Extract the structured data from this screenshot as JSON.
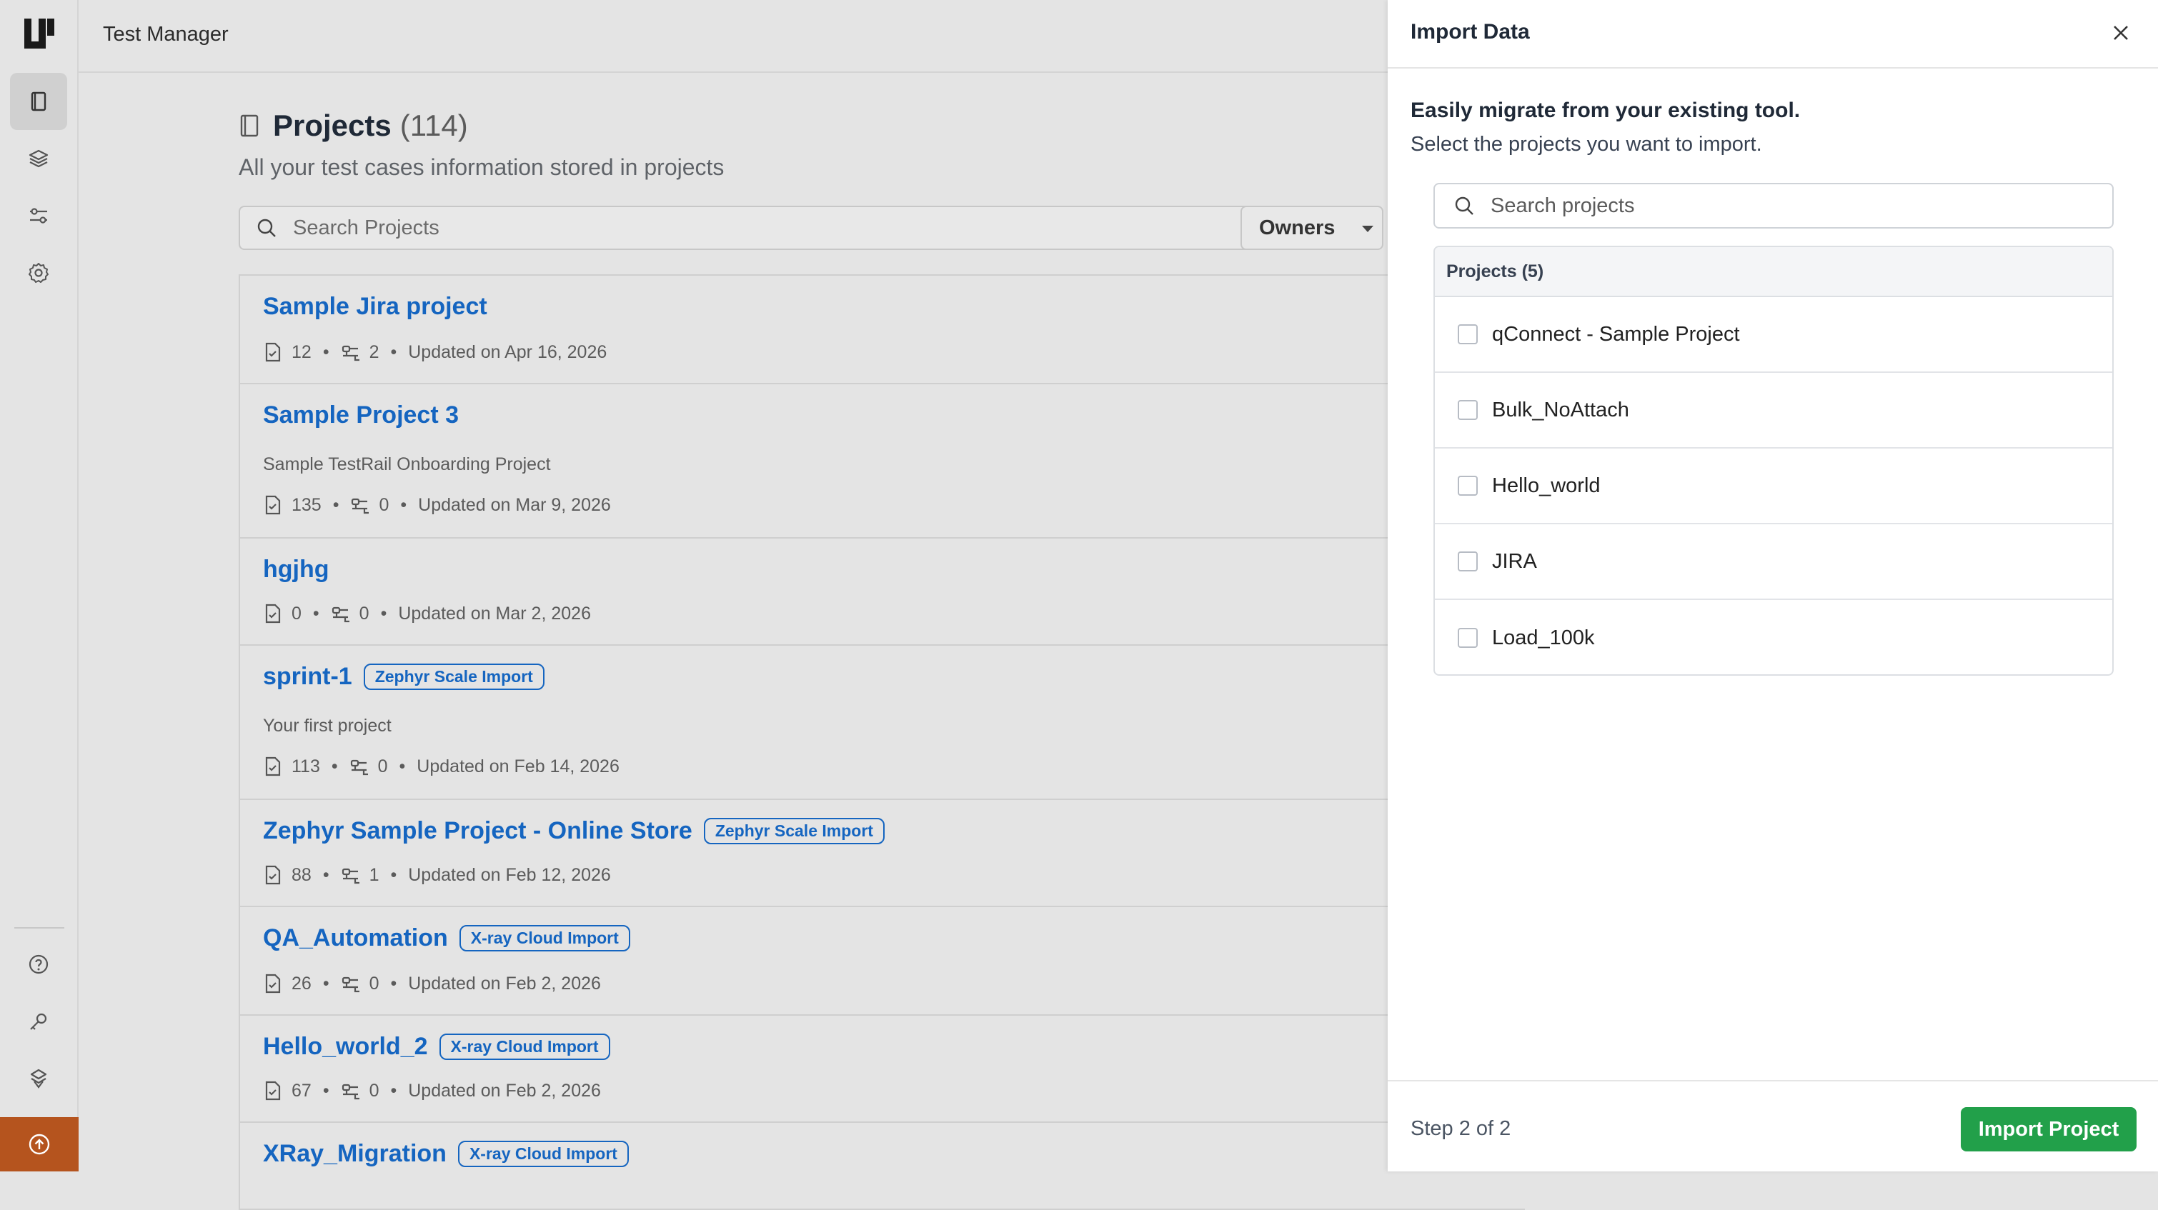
{
  "app": {
    "title": "Test Manager"
  },
  "rail": {
    "items": [
      {
        "icon": "book-icon",
        "active": true
      },
      {
        "icon": "layers-icon",
        "active": false
      },
      {
        "icon": "sliders-icon",
        "active": false
      },
      {
        "icon": "gear-icon",
        "active": false
      }
    ],
    "bottom": [
      "help-icon",
      "key-icon",
      "stack-icon",
      "upgrade-icon"
    ]
  },
  "projects_page": {
    "title": "Projects",
    "count": "(114)",
    "subtitle": "All your test cases information stored in projects",
    "search_placeholder": "Search Projects",
    "owners_label": "Owners",
    "items": [
      {
        "name": "Sample Jira project",
        "badge": "",
        "desc": "",
        "cases": "12",
        "runs": "2",
        "updated": "Updated on Apr 16, 2026"
      },
      {
        "name": "Sample Project 3",
        "badge": "",
        "desc": "Sample TestRail Onboarding Project",
        "cases": "135",
        "runs": "0",
        "updated": "Updated on Mar 9, 2026"
      },
      {
        "name": "hgjhg",
        "badge": "",
        "desc": "",
        "cases": "0",
        "runs": "0",
        "updated": "Updated on Mar 2, 2026"
      },
      {
        "name": "sprint-1",
        "badge": "Zephyr Scale Import",
        "desc": "Your first project",
        "cases": "113",
        "runs": "0",
        "updated": "Updated on Feb 14, 2026"
      },
      {
        "name": "Zephyr Sample Project - Online Store",
        "badge": "Zephyr Scale Import",
        "desc": "",
        "cases": "88",
        "runs": "1",
        "updated": "Updated on Feb 12, 2026"
      },
      {
        "name": "QA_Automation",
        "badge": "X-ray Cloud Import",
        "desc": "",
        "cases": "26",
        "runs": "0",
        "updated": "Updated on Feb 2, 2026"
      },
      {
        "name": "Hello_world_2",
        "badge": "X-ray Cloud Import",
        "desc": "",
        "cases": "67",
        "runs": "0",
        "updated": "Updated on Feb 2, 2026"
      },
      {
        "name": "XRay_Migration",
        "badge": "X-ray Cloud Import",
        "desc": "",
        "cases": "",
        "runs": "",
        "updated": ""
      }
    ]
  },
  "import_drawer": {
    "title": "Import Data",
    "intro_title": "Easily migrate from your existing tool.",
    "intro_sub": "Select the projects you want to import.",
    "search_placeholder": "Search projects",
    "table_header": "Projects (5)",
    "rows": [
      {
        "label": "qConnect - Sample Project",
        "checked": false
      },
      {
        "label": "Bulk_NoAttach",
        "checked": false
      },
      {
        "label": "Hello_world",
        "checked": false
      },
      {
        "label": "JIRA",
        "checked": false
      },
      {
        "label": "Load_100k",
        "checked": false
      }
    ],
    "step": "Step 2 of 2",
    "primary_button": "Import Project"
  },
  "colors": {
    "accent": "#1565c0",
    "success": "#22a04a",
    "upgrade": "#b5541e"
  }
}
